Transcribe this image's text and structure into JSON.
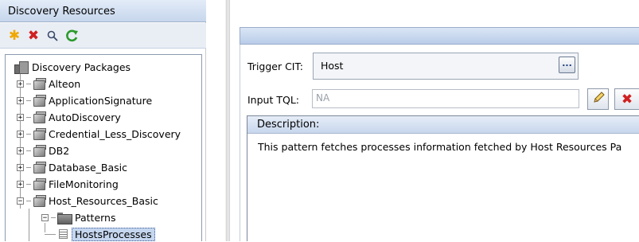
{
  "left_panel": {
    "title": "Discovery Resources",
    "toolbar": [
      {
        "name": "new-icon",
        "glyph": "✱",
        "color": "#f0a800"
      },
      {
        "name": "delete-icon",
        "glyph": "✖",
        "color": "#d02020"
      },
      {
        "name": "search-icon",
        "glyph": "🔍︎",
        "color": "#3a4a6a"
      },
      {
        "name": "refresh-icon",
        "glyph": "↻",
        "color": "#2a9a2a"
      }
    ],
    "tree": {
      "root_label": "Discovery Packages",
      "packages": [
        "Alteon",
        "ApplicationSignature",
        "AutoDiscovery",
        "Credential_Less_Discovery",
        "DB2",
        "Database_Basic",
        "FileMonitoring",
        "Host_Resources_Basic"
      ],
      "folder_label": "Patterns",
      "selected_item": "HostsProcesses"
    }
  },
  "right_panel": {
    "trigger_cit_label": "Trigger CIT:",
    "trigger_cit_value": "Host",
    "browse_button": "...",
    "input_tql_label": "Input TQL:",
    "input_tql_value": "NA",
    "description_header": "Description:",
    "description_text": "This pattern fetches processes information fetched by Host Resources Pa"
  },
  "colors": {
    "accent": "#c6d6ec",
    "selection": "#c5d6ef",
    "delete_red": "#d02020"
  }
}
